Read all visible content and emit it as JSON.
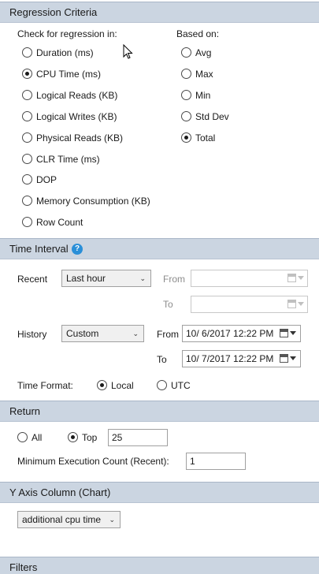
{
  "regression": {
    "header": "Regression Criteria",
    "check_label": "Check for regression in:",
    "based_label": "Based on:",
    "metrics": [
      {
        "label": "Duration (ms)",
        "selected": false
      },
      {
        "label": "CPU Time (ms)",
        "selected": true
      },
      {
        "label": "Logical Reads (KB)",
        "selected": false
      },
      {
        "label": "Logical Writes (KB)",
        "selected": false
      },
      {
        "label": "Physical Reads (KB)",
        "selected": false
      },
      {
        "label": "CLR Time (ms)",
        "selected": false
      },
      {
        "label": "DOP",
        "selected": false
      },
      {
        "label": "Memory Consumption (KB)",
        "selected": false
      },
      {
        "label": "Row Count",
        "selected": false
      }
    ],
    "aggregates": [
      {
        "label": "Avg",
        "selected": false
      },
      {
        "label": "Max",
        "selected": false
      },
      {
        "label": "Min",
        "selected": false
      },
      {
        "label": "Std Dev",
        "selected": false
      },
      {
        "label": "Total",
        "selected": true
      }
    ]
  },
  "time_interval": {
    "header": "Time Interval",
    "help_glyph": "?",
    "recent_label": "Recent",
    "recent_value": "Last hour",
    "recent_from_label": "From",
    "recent_to_label": "To",
    "history_label": "History",
    "history_value": "Custom",
    "history_from_label": "From",
    "history_from_value": "10/  6/2017 12:22 PM",
    "history_to_label": "To",
    "history_to_value": "10/  7/2017 12:22 PM",
    "format_label": "Time Format:",
    "format_local": "Local",
    "format_utc": "UTC",
    "format_selected": "Local"
  },
  "return": {
    "header": "Return",
    "all_label": "All",
    "top_label": "Top",
    "top_value": "25",
    "selected": "Top",
    "min_exec_label": "Minimum Execution Count (Recent):",
    "min_exec_value": "1"
  },
  "y_axis": {
    "header": "Y Axis Column (Chart)",
    "value": "additional cpu time"
  },
  "filters": {
    "header": "Filters"
  },
  "colors": {
    "header_bg": "#cbd5e1",
    "help_icon": "#2a8fd8"
  }
}
